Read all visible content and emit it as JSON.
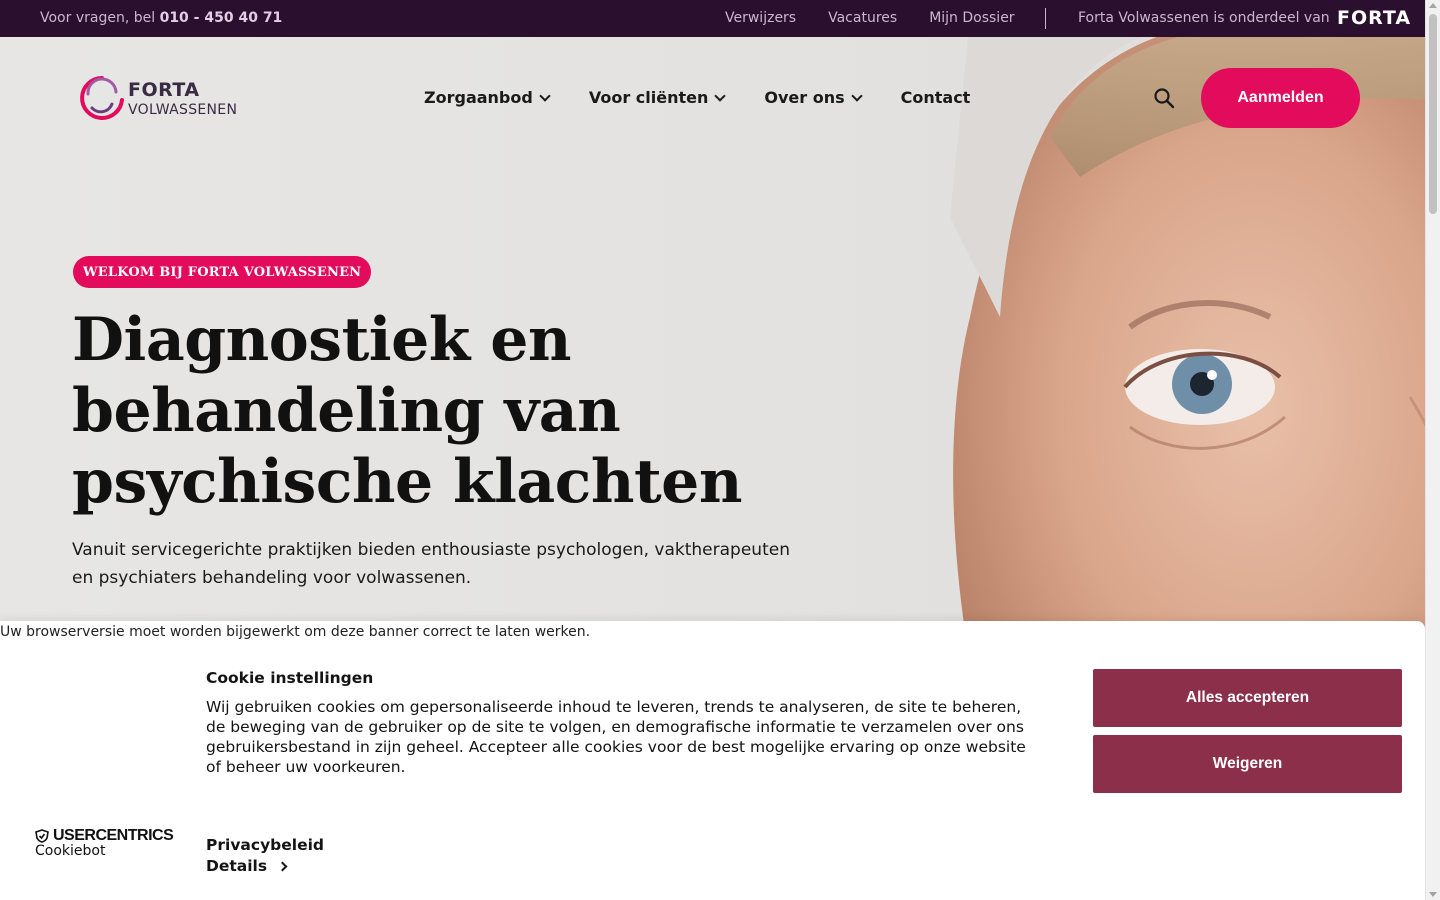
{
  "topbar": {
    "phone_prefix": "Voor vragen, bel",
    "phone_number": "010 - 450 40 71",
    "links": [
      "Verwijzers",
      "Vacatures",
      "Mijn Dossier"
    ],
    "parent_text": "Forta Volwassenen is onderdeel van",
    "parent_logo": "FORTA"
  },
  "header": {
    "logo_line1": "FORTA",
    "logo_line2": "VOLWASSENEN",
    "nav": [
      {
        "label": "Zorgaanbod",
        "dropdown": true
      },
      {
        "label": "Voor cliënten",
        "dropdown": true
      },
      {
        "label": "Over ons",
        "dropdown": true
      },
      {
        "label": "Contact",
        "dropdown": false
      }
    ],
    "search_icon": "search-icon",
    "cta_label": "Aanmelden"
  },
  "hero": {
    "badge": "WELKOM BIJ FORTA VOLWASSENEN",
    "title_lines": [
      "Diagnostiek en",
      "behandeling van",
      "psychische klachten"
    ],
    "lead_line1": "Vanuit servicegerichte praktijken bieden enthousiaste psychologen, vaktherapeuten",
    "lead_line2": "en psychiaters behandeling voor volwassenen."
  },
  "cookie": {
    "browser_warning": "Uw browserversie moet worden bijgewerkt om deze banner correct te laten werken.",
    "title": "Cookie instellingen",
    "body": "Wij gebruiken cookies om gepersonaliseerde inhoud te leveren, trends te analyseren, de site te beheren, de beweging van de gebruiker op de site te volgen, en demografische informatie te verzamelen over ons gebruikersbestand in zijn geheel. Accepteer alle cookies voor de best mogelijke ervaring op onze website of beheer uw voorkeuren.",
    "accept_label": "Alles accepteren",
    "deny_label": "Weigeren",
    "privacy_label": "Privacybeleid",
    "details_label": "Details",
    "provider_brand": "USERCENTRICS",
    "provider_sub": "Cookiebot"
  },
  "colors": {
    "topbar_bg": "#2a0f2f",
    "accent_pink": "#e30b5c",
    "cookie_button": "#8c2f4b"
  }
}
